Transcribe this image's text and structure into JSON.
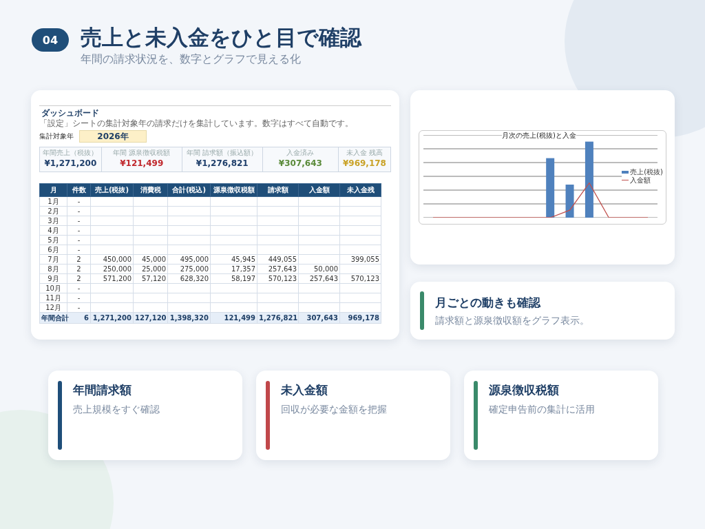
{
  "header": {
    "badge": "04",
    "title": "売上と未入金をひと目で確認",
    "subtitle": "年間の請求状況を、数字とグラフで見える化"
  },
  "dashboard": {
    "title": "ダッシュボード",
    "note": "「設定」シートの集計対象年の請求だけを集計しています。数字はすべて自動です。",
    "year_label": "集計対象年",
    "year_value": "2026年",
    "kpis": [
      {
        "label": "年間売上（税抜）",
        "value": "¥1,271,200",
        "color": "#1f3f6b"
      },
      {
        "label": "年間 源泉徴収税額",
        "value": "¥121,499",
        "color": "#c0282d"
      },
      {
        "label": "年間 請求額（振込額）",
        "value": "¥1,276,821",
        "color": "#1f3f6b"
      },
      {
        "label": "入金済み",
        "value": "¥307,643",
        "color": "#5a8a3a"
      },
      {
        "label": "未入金 残高",
        "value": "¥969,178",
        "color": "#c9a227"
      }
    ],
    "table": {
      "columns": [
        "月",
        "件数",
        "売上(税抜)",
        "消費税",
        "合計(税込)",
        "源泉徴収税額",
        "請求額",
        "入金額",
        "未入金残"
      ],
      "rows": [
        [
          "1月",
          "-",
          null,
          null,
          null,
          null,
          null,
          null,
          null
        ],
        [
          "2月",
          "-",
          null,
          null,
          null,
          null,
          null,
          null,
          null
        ],
        [
          "3月",
          "-",
          null,
          null,
          null,
          null,
          null,
          null,
          null
        ],
        [
          "4月",
          "-",
          null,
          null,
          null,
          null,
          null,
          null,
          null
        ],
        [
          "5月",
          "-",
          null,
          null,
          null,
          null,
          null,
          null,
          null
        ],
        [
          "6月",
          "-",
          null,
          null,
          null,
          null,
          null,
          null,
          null
        ],
        [
          "7月",
          "2",
          "450,000",
          "45,000",
          "495,000",
          "45,945",
          "449,055",
          null,
          "399,055"
        ],
        [
          "8月",
          "2",
          "250,000",
          "25,000",
          "275,000",
          "17,357",
          "257,643",
          "50,000",
          null
        ],
        [
          "9月",
          "2",
          "571,200",
          "57,120",
          "628,320",
          "58,197",
          "570,123",
          "257,643",
          "570,123"
        ],
        [
          "10月",
          "-",
          null,
          null,
          null,
          null,
          null,
          null,
          null
        ],
        [
          "11月",
          "-",
          null,
          null,
          null,
          null,
          null,
          null,
          null
        ],
        [
          "12月",
          "-",
          null,
          null,
          null,
          null,
          null,
          null,
          null
        ]
      ],
      "total": [
        "年間合計",
        "6",
        "1,271,200",
        "127,120",
        "1,398,320",
        "121,499",
        "1,276,821",
        "307,643",
        "969,178"
      ]
    }
  },
  "chart": {
    "title": "月次の売上(税抜)と入金",
    "legend": [
      {
        "label": "売上(税抜)",
        "kind": "bar",
        "color": "#4f81bd"
      },
      {
        "label": "入金額",
        "kind": "line",
        "color": "#c0504d"
      }
    ]
  },
  "feature": {
    "title": "月ごとの動きも確認",
    "text": "請求額と源泉徴収額をグラフ表示。",
    "color": "#3a8a6a"
  },
  "cards": [
    {
      "title": "年間請求額",
      "text": "売上規模をすぐ確認",
      "color": "#1f4e79"
    },
    {
      "title": "未入金額",
      "text": "回収が必要な金額を把握",
      "color": "#c0474a"
    },
    {
      "title": "源泉徴収税額",
      "text": "確定申告前の集計に活用",
      "color": "#3a8a6a"
    }
  ]
}
